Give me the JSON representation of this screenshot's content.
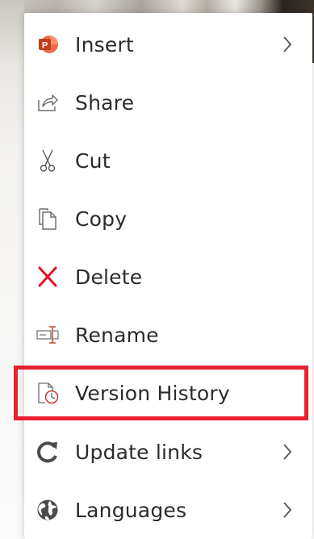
{
  "menu": {
    "items": [
      {
        "label": "Insert",
        "icon": "powerpoint-icon",
        "has_submenu": true
      },
      {
        "label": "Share",
        "icon": "share-icon",
        "has_submenu": false
      },
      {
        "label": "Cut",
        "icon": "scissors-icon",
        "has_submenu": false
      },
      {
        "label": "Copy",
        "icon": "copy-icon",
        "has_submenu": false
      },
      {
        "label": "Delete",
        "icon": "delete-x-icon",
        "has_submenu": false
      },
      {
        "label": "Rename",
        "icon": "rename-icon",
        "has_submenu": false
      },
      {
        "label": "Version History",
        "icon": "version-history-icon",
        "has_submenu": false,
        "highlighted": true
      },
      {
        "label": "Update links",
        "icon": "refresh-icon",
        "has_submenu": true
      },
      {
        "label": "Languages",
        "icon": "globe-icon",
        "has_submenu": true
      }
    ]
  },
  "colors": {
    "highlight_border": "#e8202f",
    "delete_red": "#e81123",
    "powerpoint_orange": "#d24726",
    "text": "#2b2b2b",
    "icon_gray": "#6b6b6b"
  }
}
